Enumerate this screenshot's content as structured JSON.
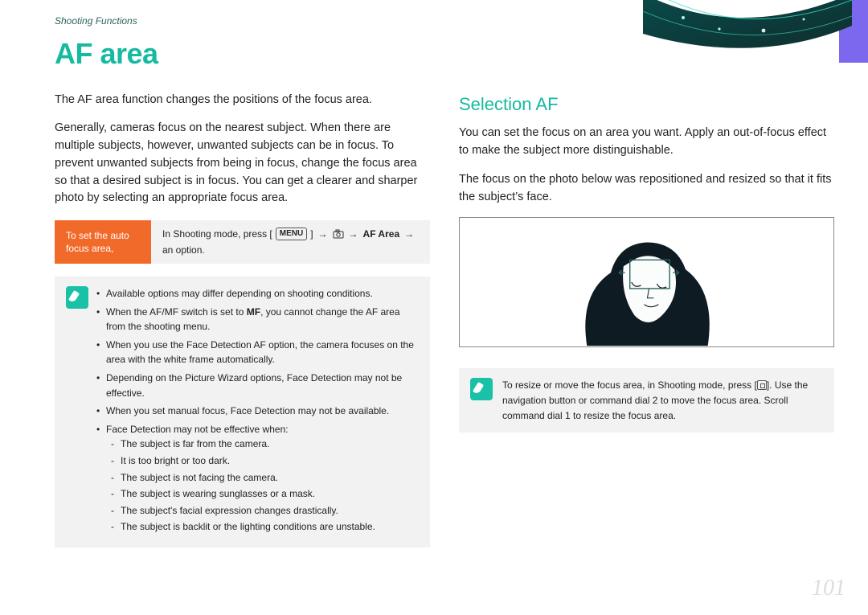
{
  "meta": {
    "breadcrumb": "Shooting Functions",
    "title": "AF area",
    "page_number": "101"
  },
  "left": {
    "p1": "The AF area function changes the positions of the focus area.",
    "p2": "Generally, cameras focus on the nearest subject. When there are multiple subjects, however, unwanted subjects can be in focus. To prevent unwanted subjects from being in focus, change the focus area so that a desired subject is in focus. You can get a clearer and sharper photo by selecting an appropriate focus area.",
    "instr_label": "To set the auto focus area,",
    "instr_body_pre": "In Shooting mode, press [",
    "instr_menu": "MENU",
    "instr_body_mid": "] ",
    "instr_af_area": "AF Area",
    "instr_body_post": "an option.",
    "notes": [
      "Available options may differ depending on shooting conditions.",
      "When the AF/MF switch is set to MF, you cannot change the AF area from the shooting menu.",
      "When you use the Face Detection AF option, the camera focuses on the area with the white frame automatically.",
      "Depending on the Picture Wizard options, Face Detection may not be effective.",
      "When you set manual focus, Face Detection may not be available.",
      "Face Detection may not be effective when:"
    ],
    "sub_notes": [
      "The subject is far from the camera.",
      "It is too bright or too dark.",
      "The subject is not facing the camera.",
      "The subject is wearing sunglasses or a mask.",
      "The subject's facial expression changes drastically.",
      "The subject is backlit or the lighting conditions are unstable."
    ]
  },
  "right": {
    "heading": "Selection AF",
    "p1": "You can set the focus on an area you want. Apply an out-of-focus effect to make the subject more distinguishable.",
    "p2": "The focus on the photo below was repositioned and resized so that it fits the subject’s face.",
    "note": "To resize or move the focus area, in Shooting mode, press [  ]. Use the navigation button or command dial 2 to move the focus area. Scroll command dial 1 to resize the focus area.",
    "note_pre": "To resize or move the focus area, in Shooting mode, press [",
    "note_post": "]. Use the navigation button or command dial 2 to move the focus area. Scroll command dial 1 to resize the focus area."
  },
  "icons": {
    "pen": "pen-icon",
    "menu": "menu-icon",
    "camera": "camera-icon",
    "ok_button": "ok-button-icon",
    "arrow": "→"
  },
  "colors": {
    "accent": "#16baa0",
    "orange": "#f26a2a",
    "purple_tab": "#7b68ee",
    "note_bg": "#f2f2f2"
  }
}
